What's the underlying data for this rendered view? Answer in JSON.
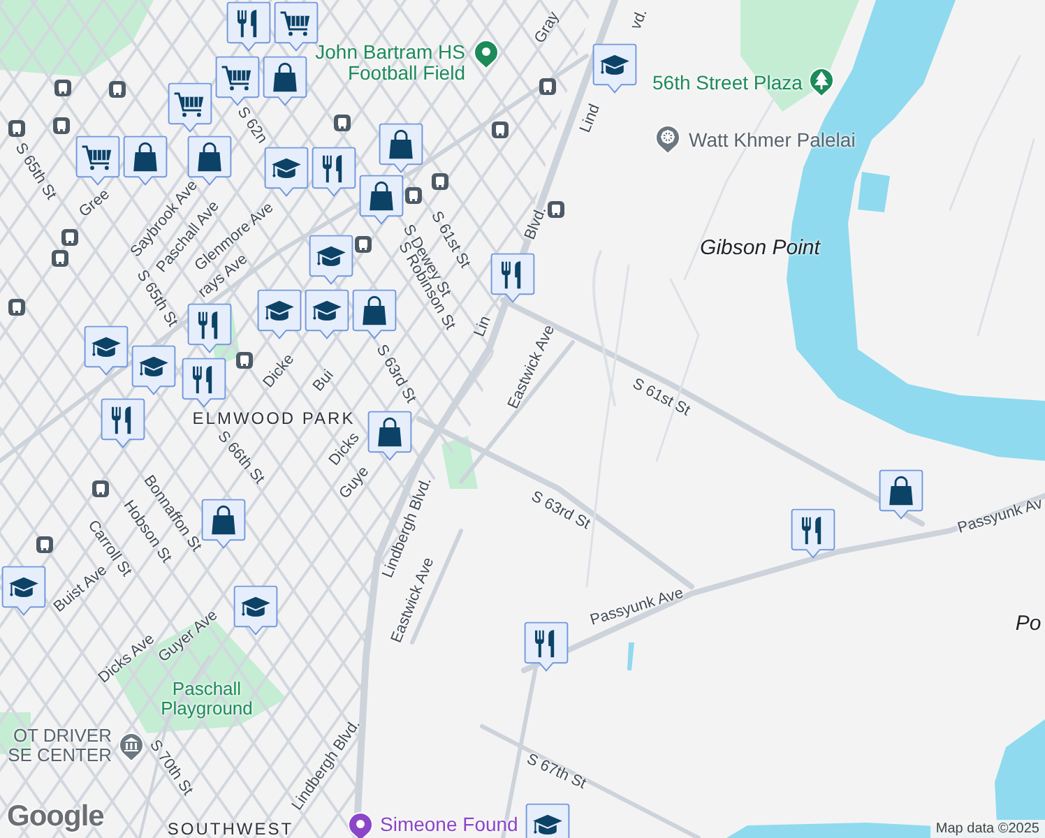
{
  "map": {
    "street_labels": [
      {
        "text": "Gray"
      },
      {
        "text": "Lind"
      },
      {
        "text": "vd."
      },
      {
        "text": "S 61st St"
      },
      {
        "text": "Lin"
      },
      {
        "text": "Blvd."
      },
      {
        "text": "Eastwick Ave"
      },
      {
        "text": "S 61st St"
      },
      {
        "text": "S 63rd St"
      },
      {
        "text": "Passyunk Ave"
      },
      {
        "text": "Passyunk Av"
      },
      {
        "text": "S 67th St"
      },
      {
        "text": "Lindbergh Blvd."
      },
      {
        "text": "Eastwick Ave"
      },
      {
        "text": "Lindbergh Blvd."
      },
      {
        "text": "S 70th St"
      },
      {
        "text": "Guyer Ave"
      },
      {
        "text": "Dicks Ave"
      },
      {
        "text": "Buist Ave"
      },
      {
        "text": "Carroll St"
      },
      {
        "text": "Hobson St"
      },
      {
        "text": "Bonnaffon St"
      },
      {
        "text": "S 66th St"
      },
      {
        "text": "Dicks"
      },
      {
        "text": "Guye"
      },
      {
        "text": "S 63rd St"
      },
      {
        "text": "S 65th St"
      },
      {
        "text": "S 65th St"
      },
      {
        "text": "Gree"
      },
      {
        "text": "Saybrook Ave"
      },
      {
        "text": "Paschall Ave"
      },
      {
        "text": "Glenmore Ave"
      },
      {
        "text": "rays Ave"
      },
      {
        "text": "S 62n"
      },
      {
        "text": "S Dewey St"
      },
      {
        "text": "S Robinson St"
      },
      {
        "text": "Dicke"
      },
      {
        "text": "Bui"
      }
    ],
    "area_labels": [
      {
        "text": "ELMWOOD PARK",
        "kind": "neighborhood"
      },
      {
        "text": "SOUTHWEST",
        "kind": "neighborhood"
      },
      {
        "text": "Gibson Point",
        "kind": "island"
      },
      {
        "text": "Po",
        "kind": "island"
      },
      {
        "text": "Paschall Playground",
        "kind": "park"
      }
    ],
    "places": [
      {
        "lines": [
          "John Bartram HS",
          "Football Field"
        ],
        "kind": "stadium"
      },
      {
        "lines": [
          "56th Street Plaza"
        ],
        "kind": "park"
      },
      {
        "lines": [
          "Watt Khmer Palelai"
        ],
        "kind": "temple"
      },
      {
        "lines": [
          "OT DRIVER",
          "SE CENTER"
        ],
        "kind": "government"
      },
      {
        "lines": [
          "Simeone Found"
        ],
        "kind": "attraction"
      }
    ],
    "markers": [
      {
        "kind": "restaurant"
      },
      {
        "kind": "grocery"
      },
      {
        "kind": "grocery"
      },
      {
        "kind": "shopping"
      },
      {
        "kind": "grocery"
      },
      {
        "kind": "shopping"
      },
      {
        "kind": "shopping"
      },
      {
        "kind": "grocery"
      },
      {
        "kind": "school"
      },
      {
        "kind": "restaurant"
      },
      {
        "kind": "shopping"
      },
      {
        "kind": "shopping"
      },
      {
        "kind": "school"
      },
      {
        "kind": "restaurant"
      },
      {
        "kind": "shopping"
      },
      {
        "kind": "school"
      },
      {
        "kind": "school"
      },
      {
        "kind": "restaurant"
      },
      {
        "kind": "school"
      },
      {
        "kind": "school"
      },
      {
        "kind": "restaurant"
      },
      {
        "kind": "restaurant"
      },
      {
        "kind": "shopping"
      },
      {
        "kind": "shopping"
      },
      {
        "kind": "school"
      },
      {
        "kind": "school"
      },
      {
        "kind": "school"
      },
      {
        "kind": "shopping"
      },
      {
        "kind": "restaurant"
      },
      {
        "kind": "restaurant"
      },
      {
        "kind": "school"
      }
    ],
    "logo": "Google",
    "attribution": "Map data ©2025"
  }
}
